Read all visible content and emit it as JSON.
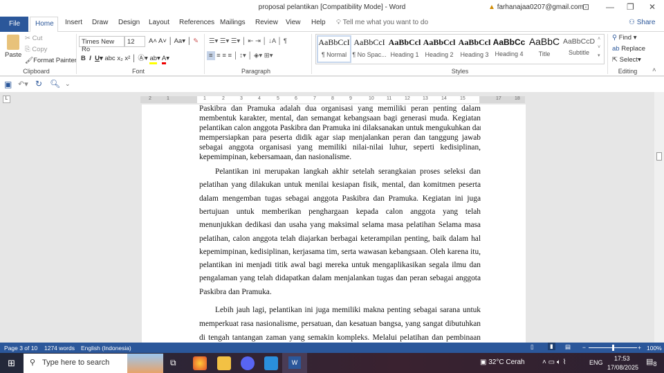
{
  "window": {
    "title": "proposal pelantikan [Compatibility Mode]  -  Word",
    "account": "farhanajaa0207@gmail.com"
  },
  "tabs": [
    "File",
    "Home",
    "Insert",
    "Draw",
    "Design",
    "Layout",
    "References",
    "Mailings",
    "Review",
    "View",
    "Help"
  ],
  "tell_me": "Tell me what you want to do",
  "share": "Share",
  "clipboard": {
    "paste": "Paste",
    "cut": "Cut",
    "copy": "Copy",
    "format_painter": "Format Painter",
    "label": "Clipboard"
  },
  "font": {
    "name": "Times New Ro",
    "size": "12",
    "label": "Font"
  },
  "paragraph": {
    "label": "Paragraph"
  },
  "styles": {
    "items": [
      {
        "sample": "AaBbCcI",
        "name": "¶ Normal"
      },
      {
        "sample": "AaBbCcI",
        "name": "¶ No Spac..."
      },
      {
        "sample": "AaBbCcl",
        "name": "Heading 1"
      },
      {
        "sample": "AaBbCcl",
        "name": "Heading 2"
      },
      {
        "sample": "AaBbCcl",
        "name": "Heading 3"
      },
      {
        "sample": "AaBbCc",
        "name": "Heading 4"
      },
      {
        "sample": "AaBbC",
        "name": "Title"
      },
      {
        "sample": "AaBbCcD",
        "name": "Subtitle"
      }
    ],
    "label": "Styles"
  },
  "editing": {
    "find": "Find",
    "replace": "Replace",
    "select": "Select",
    "label": "Editing"
  },
  "ruler": [
    "2",
    "1",
    "1",
    "2",
    "3",
    "4",
    "5",
    "6",
    "7",
    "8",
    "9",
    "10",
    "11",
    "12",
    "13",
    "14",
    "15",
    "17",
    "18"
  ],
  "document": {
    "p1": [
      "Paskibra dan Pramuka adalah dua organisasi yang memiliki peran penting dalam",
      "membentuk karakter, mental, dan semangat kebangsaan bagi generasi muda. Kegiatan",
      "pelantikan calon anggota Paskibra dan Pramuka ini dilaksanakan untuk mengukuhkan dan",
      "mempersiapkan para peserta didik agar siap menjalankan peran dan tanggung jawab",
      "sebagai anggota organisasi yang memiliki nilai-nilai luhur, seperti kedisiplinan,",
      "kepemimpinan, kebersamaan, dan nasionalisme."
    ],
    "p2": [
      "Pelantikan ini merupakan langkah akhir setelah serangkaian proses seleksi dan",
      "pelatihan yang dilakukan untuk menilai kesiapan fisik, mental, dan komitmen peserta",
      "dalam mengemban tugas sebagai anggota Paskibra dan Pramuka. Kegiatan ini juga",
      "bertujuan untuk memberikan penghargaan kepada calon anggota yang telah",
      "menunjukkan dedikasi dan usaha yang maksimal selama masa pelatihan Selama masa",
      "pelatihan, calon anggota telah diajarkan berbagai keterampilan penting, baik dalam hal",
      "kepemimpinan, kedisiplinan, kerjasama tim, serta wawasan kebangsaan. Oleh karena itu,",
      "pelantikan ini menjadi titik awal bagi mereka untuk mengaplikasikan segala ilmu dan",
      "pengalaman yang telah didapatkan dalam menjalankan tugas dan peran sebagai anggota",
      "Paskibra dan Pramuka."
    ],
    "p3": [
      "Lebih jauh lagi, pelantikan ini juga memiliki makna penting sebagai sarana untuk",
      "memperkuat rasa nasionalisme, persatuan, dan kesatuan bangsa, yang sangat dibutuhkan",
      "di tengah tantangan zaman yang semakin kompleks. Melalui pelatihan dan pembinaan"
    ]
  },
  "status": {
    "page": "Page 3 of 10",
    "words": "1274 words",
    "language": "English (Indonesia)",
    "zoom": "100%",
    "zoom_level": 100
  },
  "taskbar": {
    "search": "Type here to search",
    "weather": "32°C  Cerah",
    "lang": "ENG",
    "time": "17:53",
    "date": "17/08/2025",
    "notifications": "8"
  },
  "colors": {
    "accent": "#2b579a"
  }
}
